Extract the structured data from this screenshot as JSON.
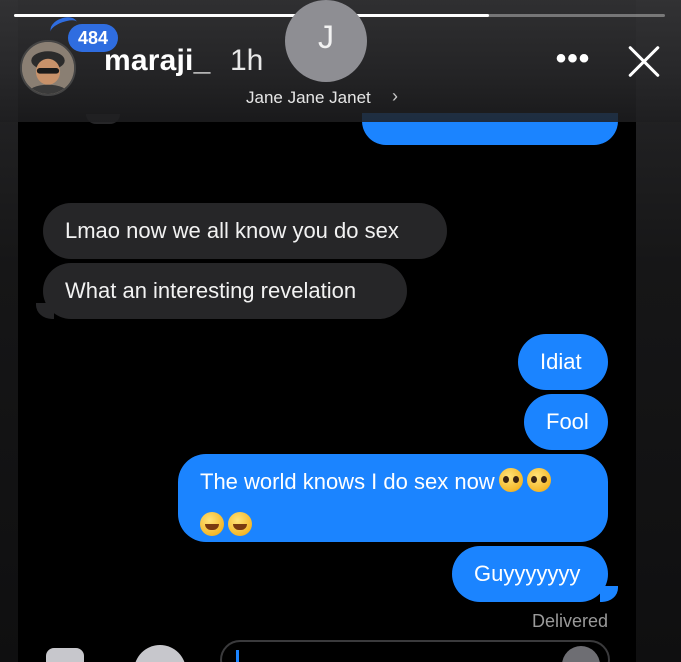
{
  "story": {
    "progress_fraction": 0.73
  },
  "header": {
    "username": "maraji_",
    "time": "1h",
    "badge_count": "484"
  },
  "conversation": {
    "contact_initial": "J",
    "contact_name": "Jane Jane Janet",
    "contact_chevron": "›",
    "more_icon": "ellipsis-icon",
    "close_icon": "close-icon"
  },
  "messages": [
    {
      "from": "them",
      "text": "Lmao now we all know you do sex"
    },
    {
      "from": "them",
      "text": "What an interesting revelation"
    },
    {
      "from": "me",
      "text": "Idiat"
    },
    {
      "from": "me",
      "text": "Fool"
    },
    {
      "from": "me",
      "text": "The world knows I do sex now"
    },
    {
      "from": "me",
      "text": "Guyyyyyyy"
    }
  ],
  "status": {
    "delivered": "Delivered"
  },
  "colors": {
    "sent_bubble": "#1b84ff",
    "received_bubble": "#262628",
    "badge": "#2f6de0"
  }
}
